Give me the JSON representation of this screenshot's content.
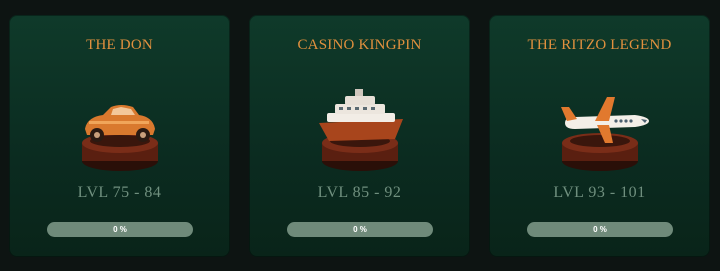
{
  "cards": [
    {
      "title": "THE DON",
      "level": "LVL 75 - 84",
      "progress_label": "0 %",
      "progress": 0,
      "icon": "vintage-car-icon"
    },
    {
      "title": "CASINO KINGPIN",
      "level": "LVL 85 - 92",
      "progress_label": "0 %",
      "progress": 0,
      "icon": "yacht-icon"
    },
    {
      "title": "THE RITZO LEGEND",
      "level": "LVL 93 - 101",
      "progress_label": "0 %",
      "progress": 0,
      "icon": "private-jet-icon"
    }
  ],
  "colors": {
    "title": "#e0903e",
    "level": "#6f8f7e",
    "bar_track": "#6f8a7a",
    "card_bg": "#0f3a2a"
  }
}
